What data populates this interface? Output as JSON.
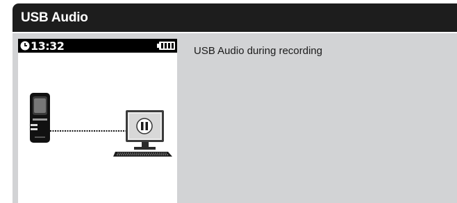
{
  "header": {
    "title": "USB Audio"
  },
  "device_screen": {
    "time": "13:32",
    "icons": [
      "clock-icon",
      "battery-icon",
      "recorder-device-icon",
      "computer-icon",
      "pause-icon"
    ]
  },
  "caption": "USB Audio during recording"
}
